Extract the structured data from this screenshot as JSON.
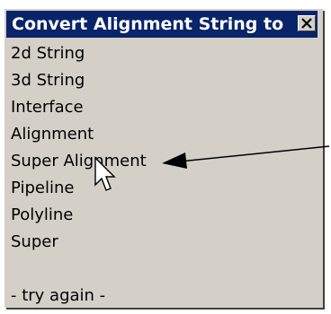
{
  "popup": {
    "title": "Convert Alignment String to",
    "close_icon": "close-icon",
    "items": [
      {
        "label": "2d String"
      },
      {
        "label": "3d String"
      },
      {
        "label": "Interface"
      },
      {
        "label": "Alignment"
      },
      {
        "label": "Super Alignment"
      },
      {
        "label": "Pipeline"
      },
      {
        "label": "Polyline"
      },
      {
        "label": "Super"
      },
      {
        "label": "- try again -"
      }
    ]
  },
  "annotation": {
    "arrow_icon": "arrow-icon",
    "cursor_icon": "mouse-cursor-icon"
  },
  "colors": {
    "titlebar": "#0a246a",
    "menu_bg": "#d4d0c8"
  }
}
